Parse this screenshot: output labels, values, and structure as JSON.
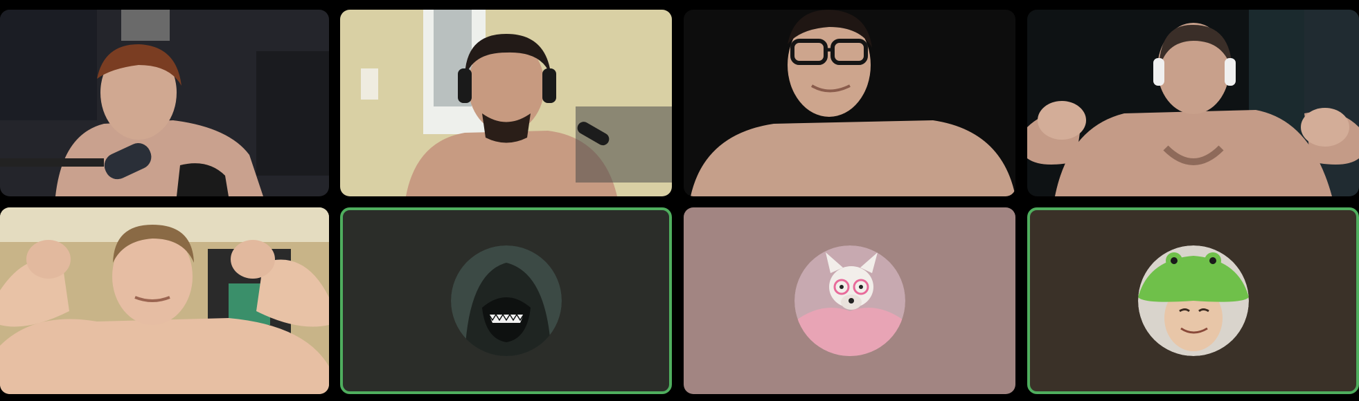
{
  "participants": [
    {
      "kind": "video",
      "speaking": false,
      "bg": "#2a2a30"
    },
    {
      "kind": "video",
      "speaking": false,
      "bg": "#d8d0a2"
    },
    {
      "kind": "video",
      "speaking": false,
      "bg": "#0d0d0d"
    },
    {
      "kind": "video",
      "speaking": false,
      "bg": "#0e1214"
    },
    {
      "kind": "video",
      "speaking": false,
      "bg": "#c8b488"
    },
    {
      "kind": "avatar",
      "speaking": true,
      "bg": "#2b2d29",
      "avatar_icon": "hooded-figure-avatar-icon"
    },
    {
      "kind": "avatar",
      "speaking": false,
      "bg": "#a28582",
      "avatar_icon": "dog-with-glasses-avatar-icon"
    },
    {
      "kind": "avatar",
      "speaking": true,
      "bg": "#3a3128",
      "avatar_icon": "frog-hat-person-avatar-icon"
    }
  ],
  "colors": {
    "speaking_border": "#4fae5e",
    "background": "#000000"
  }
}
